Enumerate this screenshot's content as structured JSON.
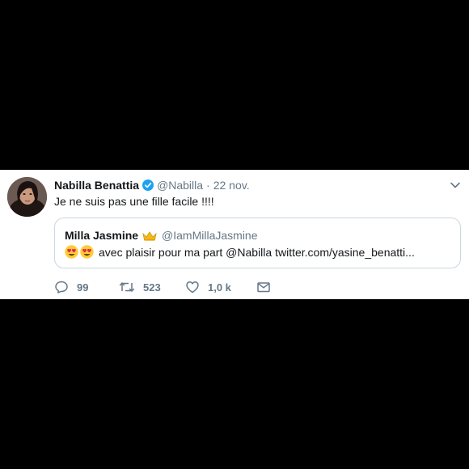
{
  "tweet": {
    "author_name": "Nabilla Benattia",
    "author_handle": "@Nabilla",
    "separator": "·",
    "date": "22 nov.",
    "text": "Je ne suis pas une fille facile !!!!",
    "quote": {
      "author_name": "Milla Jasmine",
      "author_handle": "@IamMillaJasmine",
      "emojis": [
        "heart-eyes-emoji",
        "heart-eyes-emoji"
      ],
      "text": "avec plaisir pour ma part @Nabilla twitter.com/yasine_benatti..."
    },
    "actions": {
      "replies": "99",
      "retweets": "523",
      "likes": "1,0 k"
    }
  },
  "colors": {
    "background": "#000000",
    "card": "#ffffff",
    "text": "#14171a",
    "secondary": "#657786",
    "verified": "#1da1f2",
    "border": "#ccd6dd"
  }
}
